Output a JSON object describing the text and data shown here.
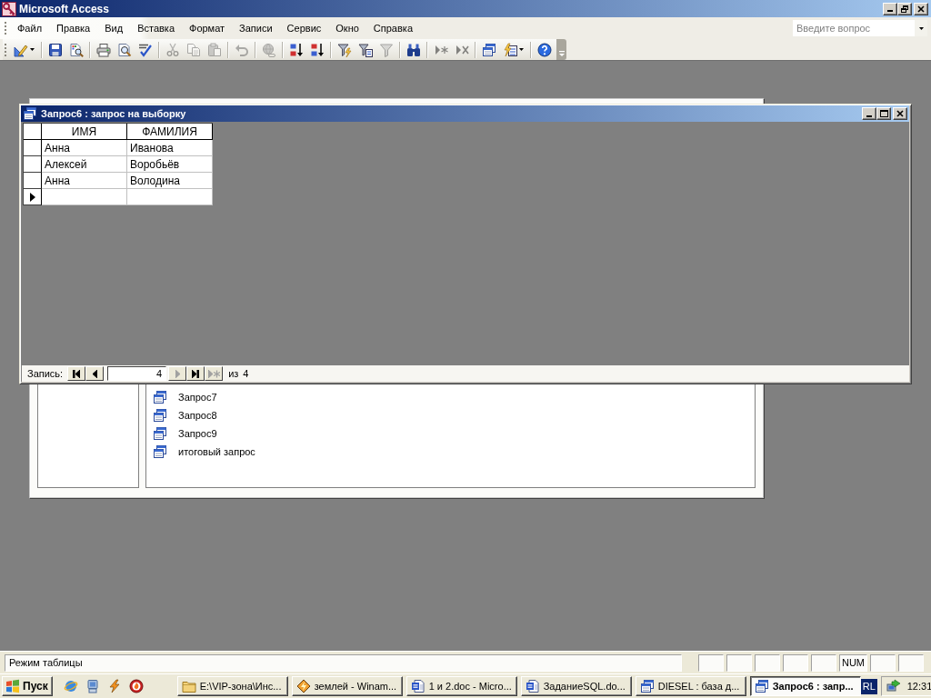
{
  "window": {
    "title": "Microsoft Access"
  },
  "menu_bar": {
    "items": [
      "Файл",
      "Правка",
      "Вид",
      "Вставка",
      "Формат",
      "Записи",
      "Сервис",
      "Окно",
      "Справка"
    ]
  },
  "help_box": {
    "placeholder": "Введите вопрос"
  },
  "toolbar": {
    "groups": [
      [
        {
          "disabled": false,
          "dropdown": true
        }
      ],
      [
        {
          "disabled": false,
          "dropdown": false
        },
        {
          "disabled": false,
          "dropdown": false
        }
      ],
      [
        {
          "disabled": false,
          "dropdown": false
        },
        {
          "disabled": false,
          "dropdown": false
        },
        {
          "disabled": false,
          "dropdown": false
        }
      ],
      [
        {
          "disabled": true,
          "dropdown": false
        },
        {
          "disabled": true,
          "dropdown": false
        },
        {
          "disabled": true,
          "dropdown": false
        }
      ],
      [
        {
          "disabled": true,
          "dropdown": false
        }
      ],
      [
        {
          "disabled": true,
          "dropdown": false
        }
      ],
      [
        {
          "disabled": false,
          "dropdown": false
        },
        {
          "disabled": false,
          "dropdown": false
        }
      ],
      [
        {
          "disabled": false,
          "dropdown": false
        },
        {
          "disabled": false,
          "dropdown": false
        },
        {
          "disabled": true,
          "dropdown": false
        }
      ],
      [
        {
          "disabled": false,
          "dropdown": false
        }
      ],
      [
        {
          "disabled": true,
          "dropdown": false
        },
        {
          "disabled": true,
          "dropdown": false
        }
      ],
      [
        {
          "disabled": false,
          "dropdown": false
        },
        {
          "disabled": false,
          "dropdown": true
        }
      ],
      [
        {
          "disabled": false,
          "dropdown": false
        }
      ]
    ]
  },
  "database_window": {
    "items": [
      "Запрос7",
      "Запрос8",
      "Запрос9",
      "итоговый запрос"
    ]
  },
  "query_window": {
    "title": "Запрос6 : запрос на выборку",
    "columns": [
      "ИМЯ",
      "ФАМИЛИЯ"
    ],
    "rows": [
      {
        "cells": [
          "Анна",
          "Иванова"
        ],
        "current": false
      },
      {
        "cells": [
          "Алексей",
          "Воробьёв"
        ],
        "current": false
      },
      {
        "cells": [
          "Анна",
          "Володина"
        ],
        "current": false
      }
    ],
    "new_row": {
      "current": true
    },
    "record_nav": {
      "label": "Запись:",
      "current": "4",
      "of_label": "из",
      "total": "4",
      "buttons": [
        {
          "disabled": false
        },
        {
          "disabled": false
        },
        {
          "disabled": true
        },
        {
          "disabled": false
        },
        {
          "disabled": true
        }
      ]
    }
  },
  "status_bar": {
    "text": "Режим таблицы",
    "indicator": "NUM"
  },
  "taskbar": {
    "start": "Пуск",
    "tasks": [
      {
        "label": "E:\\VIP-зона\\Инс...",
        "kind": "folder",
        "selected": false
      },
      {
        "label": "землей - Winam...",
        "kind": "player",
        "selected": false
      },
      {
        "label": "1 и 2.doc - Micro...",
        "kind": "document",
        "selected": false
      },
      {
        "label": "ЗаданиеSQL.do...",
        "kind": "document",
        "selected": false
      },
      {
        "label": "DIESEL : база д...",
        "kind": "database",
        "selected": false
      },
      {
        "label": "Запрос6 : запр...",
        "kind": "database",
        "selected": true
      }
    ],
    "language": "RL",
    "clock": "12:31"
  }
}
